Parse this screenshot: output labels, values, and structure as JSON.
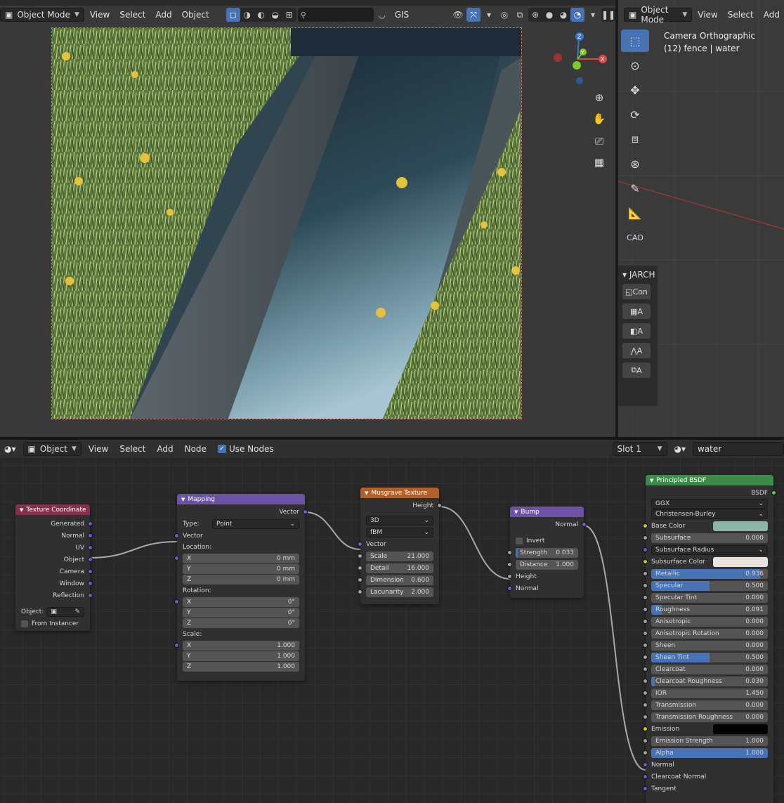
{
  "viewport": {
    "mode": "Object Mode",
    "menus": [
      "View",
      "Select",
      "Add",
      "Object"
    ],
    "gis_label": "GIS"
  },
  "side_viewport": {
    "mode": "Object Mode",
    "menus": [
      "View",
      "Select",
      "Add"
    ],
    "camera_line1": "Camera Orthographic",
    "camera_line2": "(12) fence | water",
    "cad_label": "CAD",
    "panel_title": "JARCH",
    "panel_first_btn": "Con",
    "panel_btn_suffix": "A"
  },
  "node_editor": {
    "type": "Object",
    "menus": [
      "View",
      "Select",
      "Add",
      "Node"
    ],
    "use_nodes": "Use Nodes",
    "slot": "Slot 1",
    "material": "water"
  },
  "nodes": {
    "texcoord": {
      "title": "Texture Coordinate",
      "outputs": [
        "Generated",
        "Normal",
        "UV",
        "Object",
        "Camera",
        "Window",
        "Reflection"
      ],
      "object_label": "Object:",
      "from_instancer": "From Instancer"
    },
    "mapping": {
      "title": "Mapping",
      "output": "Vector",
      "type_label": "Type:",
      "type_value": "Point",
      "vector_label": "Vector",
      "location_label": "Location:",
      "location": [
        {
          "axis": "X",
          "value": "0 mm"
        },
        {
          "axis": "Y",
          "value": "0 mm"
        },
        {
          "axis": "Z",
          "value": "0 mm"
        }
      ],
      "rotation_label": "Rotation:",
      "rotation": [
        {
          "axis": "X",
          "value": "0°"
        },
        {
          "axis": "Y",
          "value": "0°"
        },
        {
          "axis": "Z",
          "value": "0°"
        }
      ],
      "scale_label": "Scale:",
      "scale": [
        {
          "axis": "X",
          "value": "1.000"
        },
        {
          "axis": "Y",
          "value": "1.000"
        },
        {
          "axis": "Z",
          "value": "1.000"
        }
      ]
    },
    "musgrave": {
      "title": "Musgrave Texture",
      "output": "Height",
      "dimensions": "3D",
      "type": "fBM",
      "vector_label": "Vector",
      "params": [
        {
          "label": "Scale",
          "value": "21.000"
        },
        {
          "label": "Detail",
          "value": "16.000"
        },
        {
          "label": "Dimension",
          "value": "0.600"
        },
        {
          "label": "Lacunarity",
          "value": "2.000"
        }
      ]
    },
    "bump": {
      "title": "Bump",
      "output": "Normal",
      "invert": "Invert",
      "strength_label": "Strength",
      "strength": "0.033",
      "distance_label": "Distance",
      "distance": "1.000",
      "height": "Height",
      "normal": "Normal"
    },
    "bsdf": {
      "title": "Principled BSDF",
      "output": "BSDF",
      "distribution": "GGX",
      "subsurface_method": "Christensen-Burley",
      "base_color_label": "Base Color",
      "base_color": "#8fb4a9",
      "subsurface_color_label": "Subsurface Color",
      "subsurface_color": "#e8e4dc",
      "subsurface_radius": "Subsurface Radius",
      "emission_label": "Emission",
      "emission_color": "#000000",
      "normal": "Normal",
      "clearcoat_normal": "Clearcoat Normal",
      "tangent": "Tangent",
      "params_a": [
        {
          "label": "Subsurface",
          "value": "0.000",
          "fill": 0
        }
      ],
      "params_b": [
        {
          "label": "Metallic",
          "value": "0.936",
          "fill": 0.936
        },
        {
          "label": "Specular",
          "value": "0.500",
          "fill": 0.5
        },
        {
          "label": "Specular Tint",
          "value": "0.000",
          "fill": 0
        },
        {
          "label": "Roughness",
          "value": "0.091",
          "fill": 0.091
        },
        {
          "label": "Anisotropic",
          "value": "0.000",
          "fill": 0
        },
        {
          "label": "Anisotropic Rotation",
          "value": "0.000",
          "fill": 0
        },
        {
          "label": "Sheen",
          "value": "0.000",
          "fill": 0
        },
        {
          "label": "Sheen Tint",
          "value": "0.500",
          "fill": 0.5
        },
        {
          "label": "Clearcoat",
          "value": "0.000",
          "fill": 0
        },
        {
          "label": "Clearcoat Roughness",
          "value": "0.030",
          "fill": 0.03
        },
        {
          "label": "IOR",
          "value": "1.450",
          "fill": 0
        },
        {
          "label": "Transmission",
          "value": "0.000",
          "fill": 0
        },
        {
          "label": "Transmission Roughness",
          "value": "0.000",
          "fill": 0
        }
      ],
      "params_c": [
        {
          "label": "Emission Strength",
          "value": "1.000",
          "fill": 0
        },
        {
          "label": "Alpha",
          "value": "1.000",
          "fill": 1
        }
      ]
    }
  }
}
